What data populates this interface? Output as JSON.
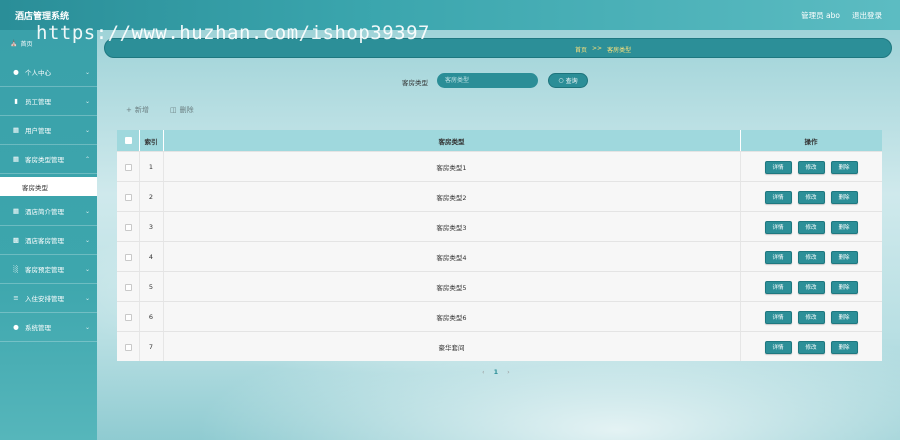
{
  "app": {
    "title": "酒店管理系统"
  },
  "header": {
    "user_label": "管理员 abo",
    "logout_label": "退出登录"
  },
  "watermark": "https://www.huzhan.com/ishop39397",
  "home_tab": "首页",
  "breadcrumb": {
    "home": "首页",
    "sep": ">>",
    "current": "客房类型"
  },
  "sidebar": {
    "items": [
      {
        "label": "个人中心",
        "icon": "user-icon"
      },
      {
        "label": "员工管理",
        "icon": "chart-icon"
      },
      {
        "label": "用户管理",
        "icon": "grid-icon"
      },
      {
        "label": "客房类型管理",
        "icon": "grid-icon"
      },
      {
        "label": "酒店简介管理",
        "icon": "grid-icon"
      },
      {
        "label": "酒店客房管理",
        "icon": "book-icon"
      },
      {
        "label": "客房预定管理",
        "icon": "bar-chart-icon"
      },
      {
        "label": "入住安排管理",
        "icon": "sliders-icon"
      },
      {
        "label": "系统管理",
        "icon": "user-icon"
      }
    ],
    "sub_item": "客房类型"
  },
  "search": {
    "label": "客房类型",
    "placeholder": "客房类型",
    "button": "查询"
  },
  "actions": {
    "add": "新增",
    "delete": "删除"
  },
  "table": {
    "headers": {
      "index": "索引",
      "type": "客房类型",
      "ops": "操作"
    },
    "rows": [
      {
        "index": "1",
        "type": "客房类型1"
      },
      {
        "index": "2",
        "type": "客房类型2"
      },
      {
        "index": "3",
        "type": "客房类型3"
      },
      {
        "index": "4",
        "type": "客房类型4"
      },
      {
        "index": "5",
        "type": "客房类型5"
      },
      {
        "index": "6",
        "type": "客房类型6"
      },
      {
        "index": "7",
        "type": "豪华套间"
      }
    ],
    "row_buttons": {
      "detail": "详情",
      "edit": "修改",
      "delete": "删除"
    }
  },
  "pagination": {
    "prev": "‹",
    "current": "1",
    "next": "›"
  },
  "colors": {
    "primary": "#2c8f98",
    "header_bg": "#3aa5ad",
    "crumb_text": "#ffe27a"
  }
}
